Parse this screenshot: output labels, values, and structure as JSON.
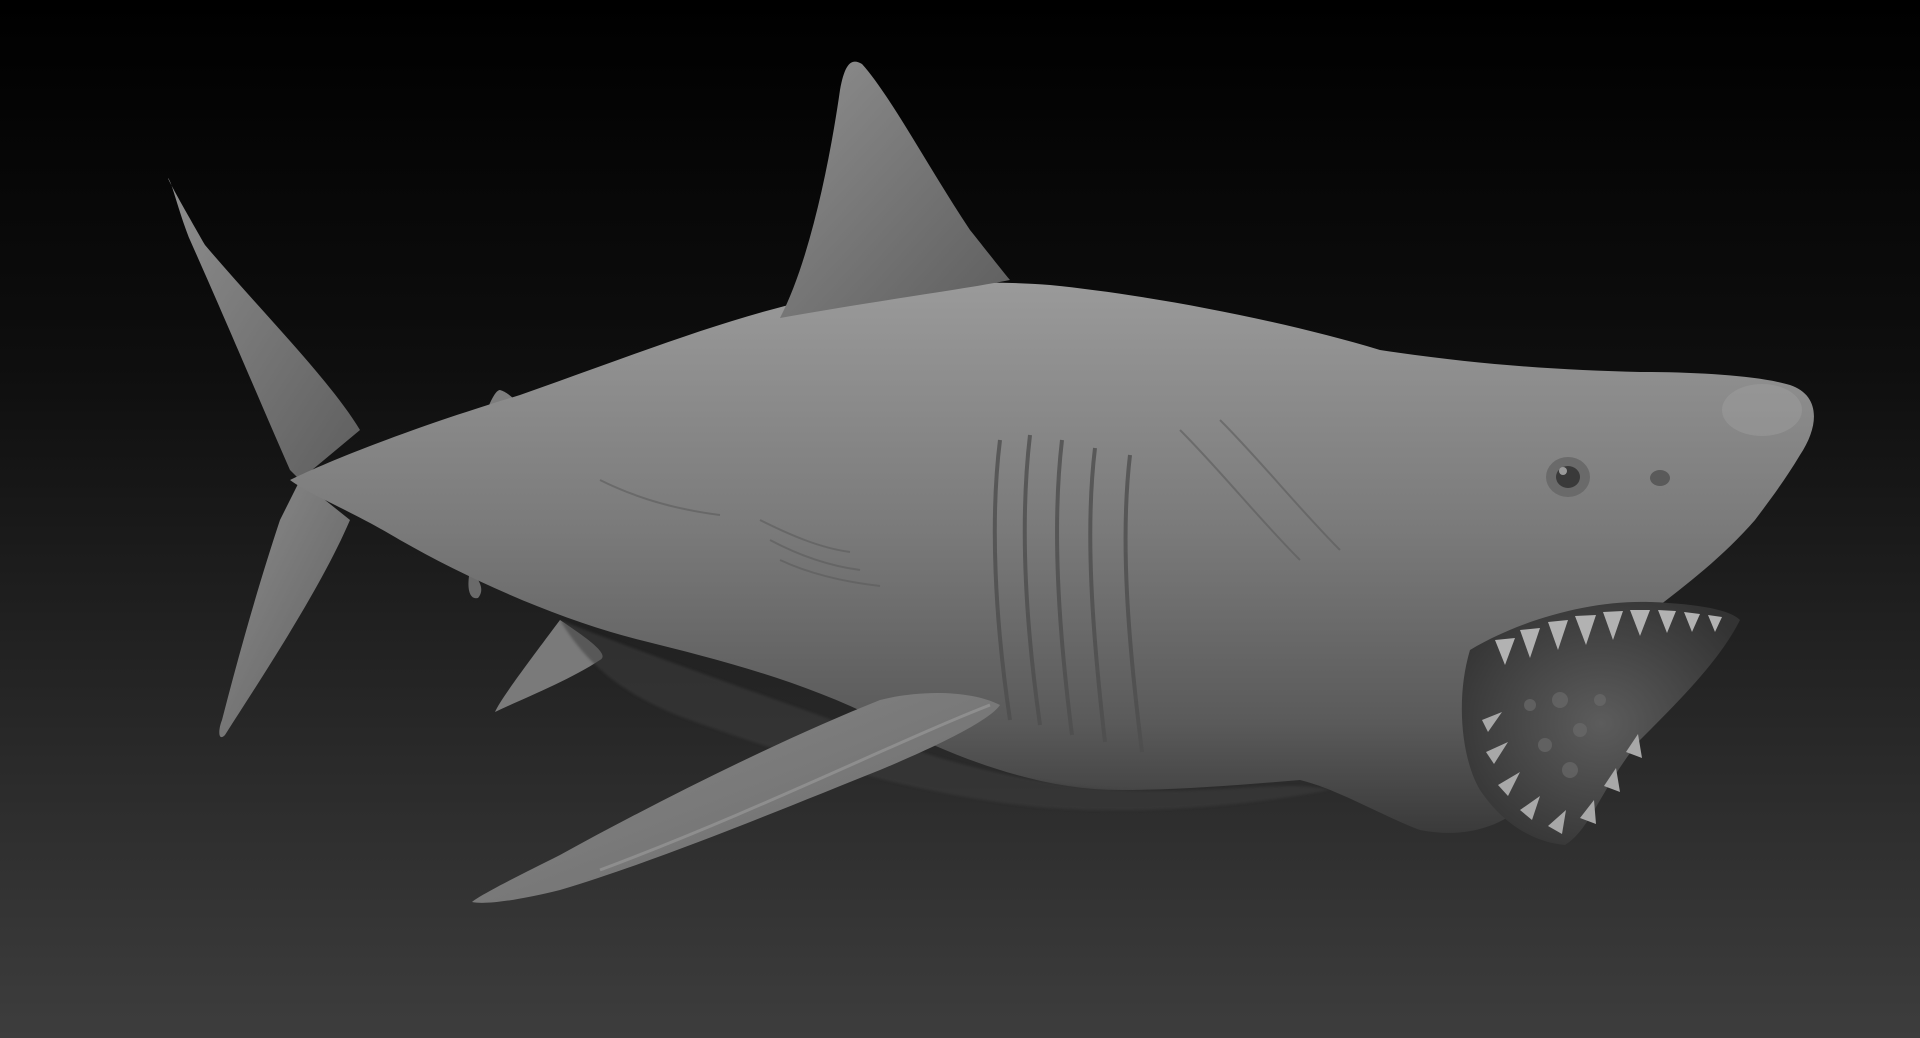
{
  "scene": {
    "subject": "great-white-shark-sculpt",
    "style": "clay-render",
    "background": {
      "top_color": "#000000",
      "bottom_color": "#3d3d3d"
    },
    "material": {
      "light_color": "#9a9a9a",
      "base_color": "#6e6e6e",
      "shadow_color": "#2e2e2e",
      "mouth_color": "#4a4a4a",
      "teeth_color": "#b0b0b0"
    }
  }
}
